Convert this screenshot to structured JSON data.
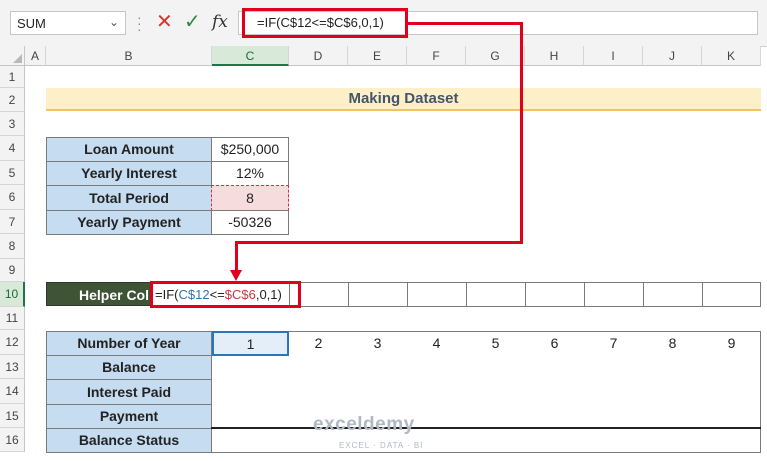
{
  "formula_bar": {
    "name_box": "SUM",
    "cancel_icon": "✕",
    "enter_icon": "✓",
    "fx_label": "fx",
    "formula": "=IF(C$12<=$C$6,0,1)"
  },
  "columns": [
    "A",
    "B",
    "C",
    "D",
    "E",
    "F",
    "G",
    "H",
    "I",
    "J",
    "K"
  ],
  "selected_column": "C",
  "rows": [
    "1",
    "2",
    "3",
    "4",
    "5",
    "6",
    "7",
    "8",
    "9",
    "10",
    "11",
    "12",
    "13",
    "14",
    "15",
    "16"
  ],
  "title": "Making Dataset",
  "loan_table": [
    {
      "label": "Loan Amount",
      "value": "$250,000"
    },
    {
      "label": "Yearly Interest",
      "value": "12%"
    },
    {
      "label": "Total Period",
      "value": "8"
    },
    {
      "label": "Yearly Payment",
      "value": "-50326"
    }
  ],
  "helper": {
    "label": "Helper Col",
    "formula_parts": [
      "=IF(",
      "C$12",
      "<=",
      "$C$6",
      ",0,1)"
    ]
  },
  "year_table": {
    "labels": [
      "Number of Year",
      "Balance",
      "Interest Paid",
      "Payment",
      "Balance Status"
    ],
    "years": [
      "1",
      "2",
      "3",
      "4",
      "5",
      "6",
      "7",
      "8",
      "9"
    ]
  },
  "watermark": {
    "brand": "exceldemy",
    "tagline": "EXCEL · DATA · BI"
  },
  "colors": {
    "red_annotation": "#e0001b",
    "label_fill": "#c5dcf1",
    "helper_fill": "#3e5435",
    "title_fill": "#fdf0c8",
    "ref_blue": "#2e75b6",
    "ref_red": "#d1343d"
  }
}
